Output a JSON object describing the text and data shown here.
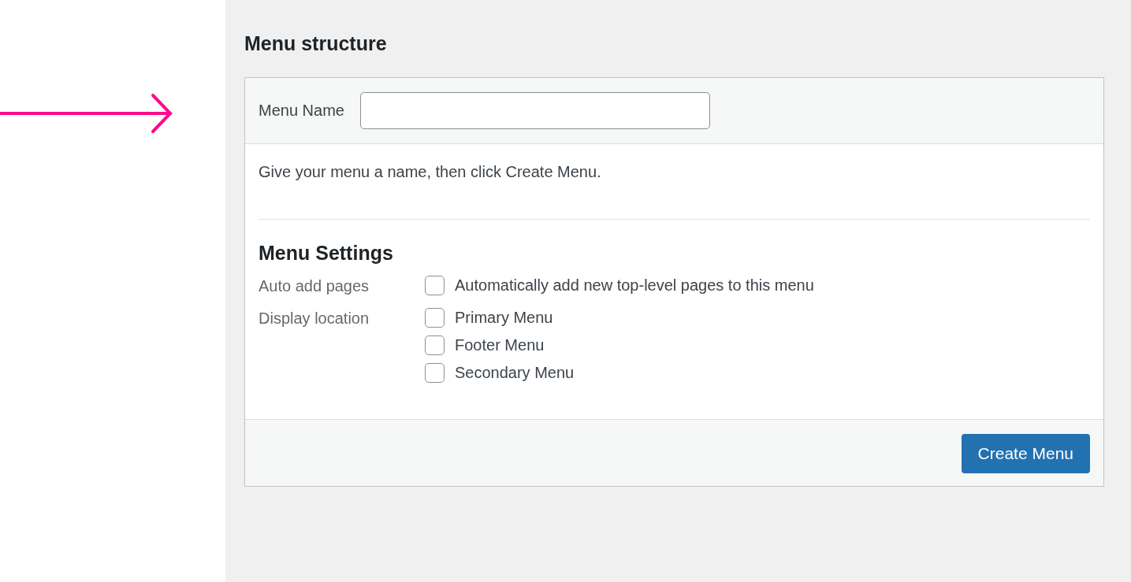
{
  "heading": "Menu structure",
  "menu_name": {
    "label": "Menu Name"
  },
  "hint": "Give your menu a name, then click Create Menu.",
  "settings": {
    "title": "Menu Settings",
    "groups": [
      {
        "label": "Auto add pages",
        "options": [
          {
            "label": "Automatically add new top-level pages to this menu",
            "checked": false
          }
        ]
      },
      {
        "label": "Display location",
        "options": [
          {
            "label": "Primary Menu",
            "checked": false
          },
          {
            "label": "Footer Menu",
            "checked": false
          },
          {
            "label": "Secondary Menu",
            "checked": false
          }
        ]
      }
    ]
  },
  "button": "Create Menu"
}
